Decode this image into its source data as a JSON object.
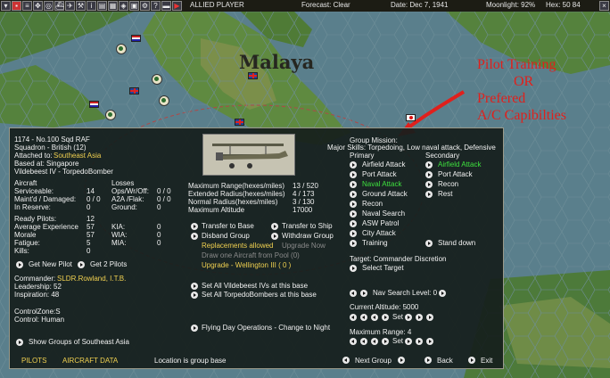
{
  "topbar": {
    "side": "ALLIED PLAYER",
    "forecast": "Forecast: Clear",
    "date": "Date: Dec 7, 1941",
    "moonlight": "Moonlight: 92%",
    "hex": "Hex: 50 84"
  },
  "map": {
    "region_label": "Malaya",
    "annotation": [
      "Pilot Training",
      "OR",
      "Prefered",
      "A/C Capibilties"
    ],
    "annotation_color": "#e0201c"
  },
  "unit": {
    "id_name": "1174 - No.100 Sqd RAF",
    "squadron": "Squadron - British (12)",
    "attached_label": "Attached to:",
    "attached_value": "Southeast Asia",
    "based_at": "Based at: Singapore",
    "aircraft_type": "Vildebeest IV - TorpedoBomber",
    "aircraft_head": "Aircraft",
    "serviceable_label": "Serviceable:",
    "serviceable_value": "14",
    "maint_label": "Maint'd / Damaged:",
    "maint_value": "0 / 0",
    "reserve_label": "In Reserve:",
    "reserve_value": "0",
    "losses_head": "Losses",
    "ops_label": "Ops/Wr/Off:",
    "ops_value": "0 / 0",
    "a2a_label": "A2A /Flak:",
    "a2a_value": "0 / 0",
    "ground_label": "Ground:",
    "ground_value": "0",
    "ready_label": "Ready Pilots:",
    "ready_value": "12",
    "exp_label": "Average Experience",
    "exp_value": "57",
    "morale_label": "Morale",
    "morale_value": "57",
    "fatigue_label": "Fatigue:",
    "fatigue_value": "5",
    "kills_label": "Kills:",
    "kills_value": "0",
    "kia_label": "KIA:",
    "kia_value": "0",
    "wia_label": "WIA:",
    "wia_value": "0",
    "mia_label": "MIA:",
    "mia_value": "0",
    "get_new_pilot": "Get New Pilot",
    "get_2_pilots": "Get 2 Pilots",
    "commander_label": "Commander:",
    "commander_value": "SLDR.Rowland, I.T.B.",
    "leadership": "Leadership: 52",
    "inspiration": "Inspiration: 48",
    "control_zone": "ControlZone:S",
    "control": "Control:  Human",
    "show_groups": "Show Groups of Southeast Asia"
  },
  "ranges": {
    "max_range_label": "Maximum Range(hexes/miles)",
    "max_range_value": "13 / 520",
    "ext_radius_label": "Extended Radius(hexes/miles)",
    "ext_radius_value": "4 / 173",
    "norm_radius_label": "Normal Radius(hexes/miles)",
    "norm_radius_value": "3 / 130",
    "max_alt_label": "Maximum Altitude",
    "max_alt_value": "17000"
  },
  "actions": {
    "transfer_base": "Transfer to Base",
    "transfer_ship": "Transfer to Ship",
    "disband": "Disband Group",
    "withdraw": "Withdraw Group",
    "replacements": "Replacements allowed",
    "upgrade_now": "Upgrade Now",
    "draw_pool": "Draw one Aircraft from Pool (0)",
    "upgrade_to": "Upgrade - Wellington III  ( 0 )",
    "set_all_vildebeest": "Set All Vildebeest IVs at this base",
    "set_all_torpedo": "Set All TorpedoBombers at this base",
    "flying_day": "Flying Day Operations - Change to Night"
  },
  "mission": {
    "head": "Group Mission:",
    "skills": "Major Skills: Torpedoing, Low naval attack, Defensive",
    "primary_head": "Primary",
    "secondary_head": "Secondary",
    "primary": [
      "Airfield Attack",
      "Port Attack",
      "Naval Attack",
      "Ground Attack",
      "Recon",
      "Naval Search",
      "ASW Patrol",
      "City Attack",
      "Training"
    ],
    "secondary": [
      "Airfield Attack",
      "Port Attack",
      "Recon",
      "Rest"
    ],
    "stand_down": "Stand down",
    "target": "Target: Commander Discretion",
    "select_target": "Select Target",
    "nav_search": "Nav Search Level: 0",
    "current_alt": "Current Altitude: 5000",
    "set": "Set",
    "max_range": "Maximum Range: 4",
    "selected_color": "#3ee03e"
  },
  "footer": {
    "pilots": "PILOTS",
    "aircraft_data": "AIRCRAFT DATA",
    "location": "Location is group base",
    "next_group": "Next Group",
    "back": "Back",
    "exit": "Exit"
  }
}
